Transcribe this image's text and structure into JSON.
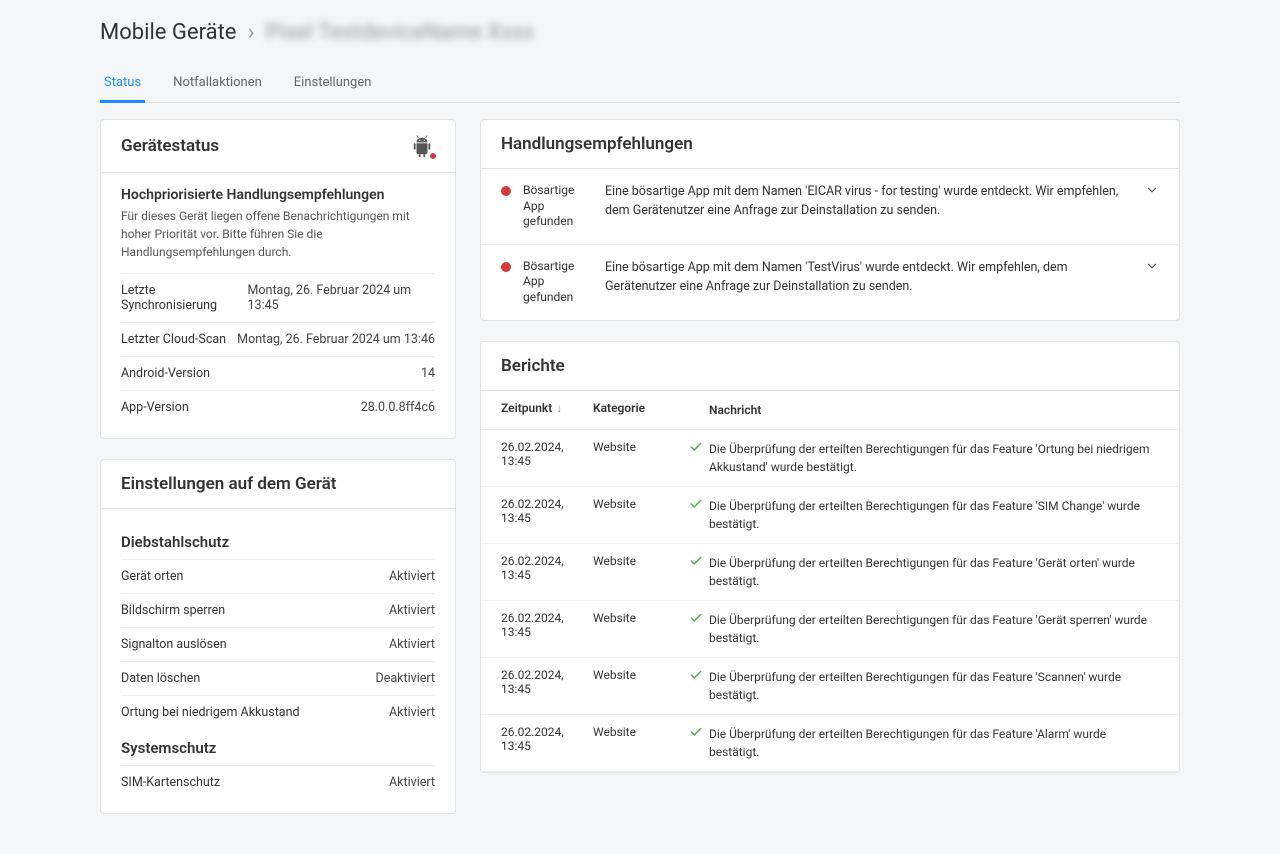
{
  "breadcrumb": {
    "root": "Mobile Geräte",
    "current_blurred": "Pixel TestdeviceName Xxxx"
  },
  "tabs": [
    {
      "label": "Status",
      "active": true
    },
    {
      "label": "Notfallaktionen",
      "active": false
    },
    {
      "label": "Einstellungen",
      "active": false
    }
  ],
  "device_status": {
    "heading": "Gerätestatus",
    "priority_title": "Hochpriorisierte Handlungsempfehlungen",
    "priority_desc": "Für dieses Gerät liegen offene Benachrichtigungen mit hoher Priorität vor. Bitte führen Sie die Handlungsempfehlungen durch.",
    "rows": [
      {
        "key": "Letzte Synchronisierung",
        "val": "Montag, 26. Februar 2024 um 13:45"
      },
      {
        "key": "Letzter Cloud-Scan",
        "val": "Montag, 26. Februar 2024 um 13:46"
      },
      {
        "key": "Android-Version",
        "val": "14"
      },
      {
        "key": "App-Version",
        "val": "28.0.0.8ff4c6"
      }
    ]
  },
  "device_settings": {
    "heading": "Einstellungen auf dem Gerät",
    "group1_title": "Diebstahlschutz",
    "group1_rows": [
      {
        "key": "Gerät orten",
        "val": "Aktiviert"
      },
      {
        "key": "Bildschirm sperren",
        "val": "Aktiviert"
      },
      {
        "key": "Signalton auslösen",
        "val": "Aktiviert"
      },
      {
        "key": "Daten löschen",
        "val": "Deaktiviert"
      },
      {
        "key": "Ortung bei niedrigem Akkustand",
        "val": "Aktiviert"
      }
    ],
    "group2_title": "Systemschutz",
    "group2_rows": [
      {
        "key": "SIM-Kartenschutz",
        "val": "Aktiviert"
      }
    ]
  },
  "recommendations": {
    "heading": "Handlungsempfehlungen",
    "items": [
      {
        "title": "Bösartige App gefunden",
        "desc": "Eine bösartige App mit dem Namen 'EICAR virus - for testing' wurde entdeckt. Wir empfehlen, dem Gerätenutzer eine Anfrage zur Deinstallation zu senden."
      },
      {
        "title": "Bösartige App gefunden",
        "desc": "Eine bösartige App mit dem Namen 'TestVirus' wurde entdeckt. Wir empfehlen, dem Gerätenutzer eine Anfrage zur Deinstallation zu senden."
      }
    ]
  },
  "reports": {
    "heading": "Berichte",
    "columns": {
      "time": "Zeitpunkt",
      "category": "Kategorie",
      "message": "Nachricht"
    },
    "rows": [
      {
        "time": "26.02.2024, 13:45",
        "category": "Website",
        "message": "Die Überprüfung der erteilten Berechtigungen für das Feature 'Ortung bei niedrigem Akkustand' wurde bestätigt."
      },
      {
        "time": "26.02.2024, 13:45",
        "category": "Website",
        "message": "Die Überprüfung der erteilten Berechtigungen für das Feature 'SIM Change' wurde bestätigt."
      },
      {
        "time": "26.02.2024, 13:45",
        "category": "Website",
        "message": "Die Überprüfung der erteilten Berechtigungen für das Feature 'Gerät orten' wurde bestätigt."
      },
      {
        "time": "26.02.2024, 13:45",
        "category": "Website",
        "message": "Die Überprüfung der erteilten Berechtigungen für das Feature 'Gerät sperren' wurde bestätigt."
      },
      {
        "time": "26.02.2024, 13:45",
        "category": "Website",
        "message": "Die Überprüfung der erteilten Berechtigungen für das Feature 'Scannen' wurde bestätigt."
      },
      {
        "time": "26.02.2024, 13:45",
        "category": "Website",
        "message": "Die Überprüfung der erteilten Berechtigungen für das Feature 'Alarm' wurde bestätigt."
      }
    ]
  }
}
